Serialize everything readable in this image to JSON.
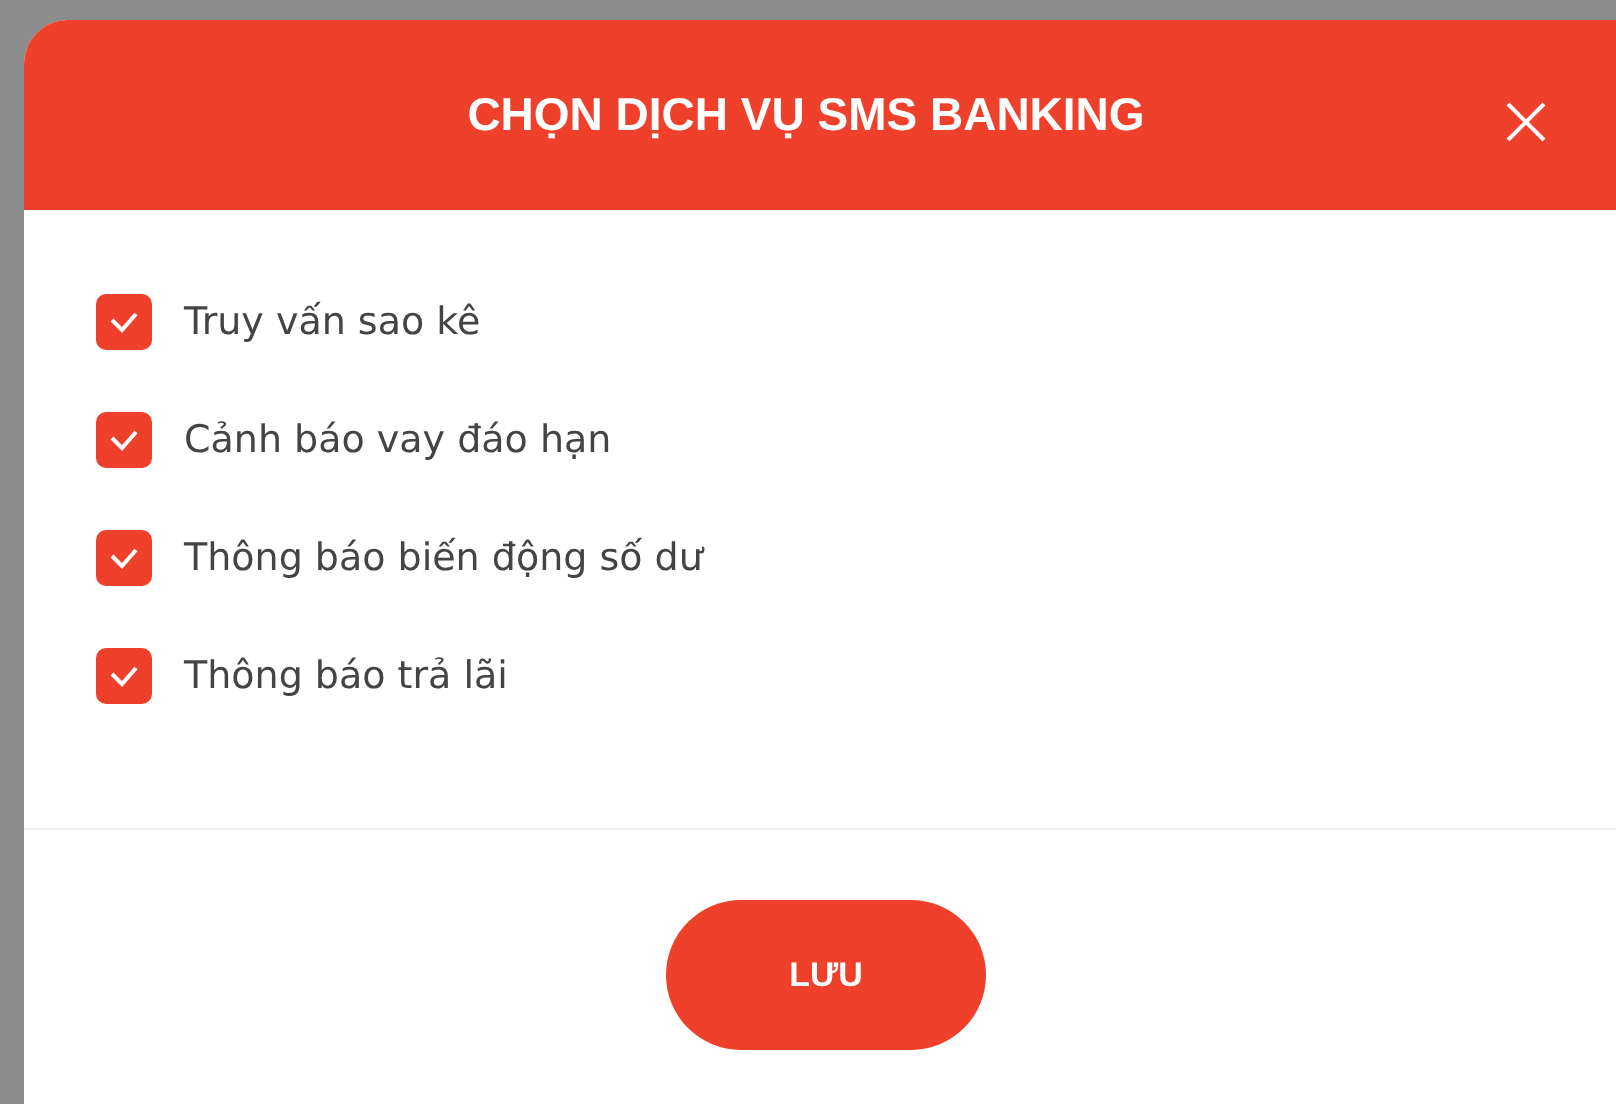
{
  "dialog": {
    "title": "CHỌN DỊCH VỤ SMS BANKING",
    "options": [
      {
        "label": "Truy vấn sao kê",
        "checked": true
      },
      {
        "label": "Cảnh báo vay đáo hạn",
        "checked": true
      },
      {
        "label": "Thông báo biến động số dư",
        "checked": true
      },
      {
        "label": "Thông báo trả lãi",
        "checked": true
      }
    ],
    "save_button": "LƯU"
  }
}
